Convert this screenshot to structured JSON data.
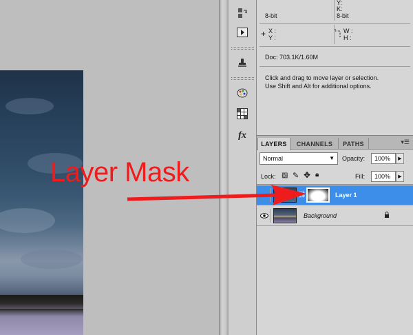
{
  "info_panel": {
    "k_label": "K:",
    "y_label": "Y:",
    "bitdepth_left": "8-bit",
    "bitdepth_right": "8-bit",
    "x_label": "X :",
    "y_coord_label": "Y :",
    "w_label": "W :",
    "h_label": "H :",
    "doc_size": "Doc: 703.1K/1.60M",
    "hint_line1": "Click and drag to move layer or selection.",
    "hint_line2": "Use Shift and Alt for additional options."
  },
  "layers_panel": {
    "tabs": [
      "LAYERS",
      "CHANNELS",
      "PATHS"
    ],
    "menu_icon": "panel-menu-icon",
    "blend_mode": "Normal",
    "opacity_label": "Opacity:",
    "opacity_value": "100%",
    "lock_label": "Lock:",
    "fill_label": "Fill:",
    "fill_value": "100%",
    "layers": [
      {
        "name": "Layer 1",
        "selected": true,
        "has_mask": true
      },
      {
        "name": "Background",
        "selected": false,
        "locked": true
      }
    ]
  },
  "annotation": {
    "label": "Layer Mask",
    "color": "#ee1c1c"
  },
  "colors": {
    "selection": "#3d8ee8",
    "panel_bg": "#d6d6d6",
    "canvas_bg": "#bebebe"
  }
}
